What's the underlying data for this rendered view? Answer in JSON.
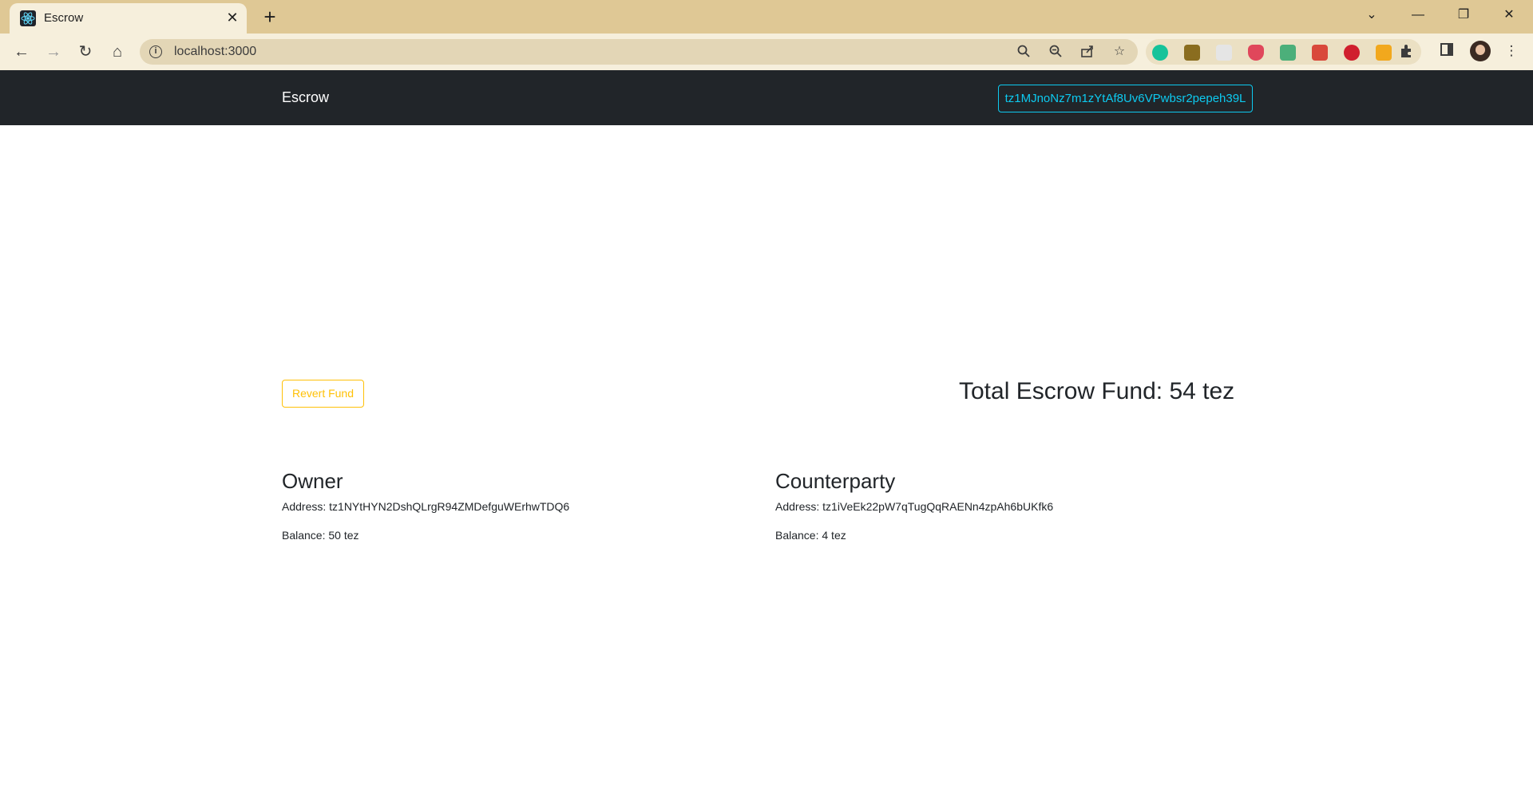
{
  "browser": {
    "tab_title": "Escrow",
    "tab_close": "✕",
    "new_tab": "+",
    "url": "localhost:3000",
    "window_controls": {
      "tab_search": "⌄",
      "minimize": "—",
      "restore": "❐",
      "close": "✕"
    },
    "nav": {
      "back": "←",
      "forward": "→",
      "reload": "↻",
      "home": "⌂"
    },
    "icons": [
      "search-icon",
      "zoom-out-icon",
      "share-icon",
      "bookmark-star-icon",
      "extensions-icon",
      "side-panel-icon",
      "profile-avatar"
    ],
    "colors": {
      "tabbar": "#dfc895",
      "toolbar": "#f6efdc",
      "omnibox": "#e3d6b6"
    }
  },
  "app": {
    "brand": "Escrow",
    "wallet_address": "tz1MJnoNz7m1zYtAf8Uv6VPwbsr2pepeh39L",
    "revert_button": "Revert Fund",
    "total_label": "Total Escrow Fund: 54 tez",
    "owner": {
      "heading": "Owner",
      "address": "Address: tz1NYtHYN2DshQLrgR94ZMDefguWErhwTDQ6",
      "balance": "Balance: 50 tez"
    },
    "counterparty": {
      "heading": "Counterparty",
      "address": "Address: tz1iVeEk22pW7qTugQqRAENn4zpAh6bUKfk6",
      "balance": "Balance: 4 tez"
    },
    "colors": {
      "navbar": "#212529",
      "info": "#0dcaf0",
      "warning": "#ffc107",
      "text": "#212529"
    }
  }
}
